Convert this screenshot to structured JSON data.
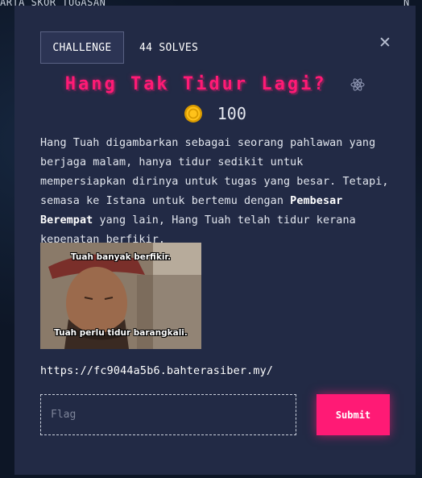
{
  "background": {
    "nav_left": "ARTA SKOR  TUGASAN",
    "nav_right": "N"
  },
  "modal": {
    "tag_label": "CHALLENGE",
    "solves": "44 SOLVES",
    "close_icon": "close-icon",
    "title": "Hang Tak Tidur Lagi?",
    "difficulty_icon": "atom-icon",
    "points_icon": "coin-icon",
    "points": "100",
    "description": {
      "part1": "Hang Tuah digambarkan sebagai seorang pahlawan yang berjaga malam, hanya tidur sedikit untuk mempersiapkan dirinya untuk tugas yang besar. Tetapi, semasa ke Istana untuk bertemu dengan ",
      "bold": "Pembesar Berempat",
      "part2": " yang lain, Hang Tuah telah tidur kerana kepenatan berfikir."
    },
    "meme": {
      "top_text": "Tuah banyak berfikir.",
      "bottom_text": "Tuah perlu tidur barangkali."
    },
    "link": "https://fc9044a5b6.bahterasiber.my/",
    "flag_placeholder": "Flag",
    "flag_value": "",
    "submit_label": "Submit"
  },
  "colors": {
    "accent": "#ff1a75",
    "modal_bg": "#222a45",
    "page_bg": "#0d1626"
  }
}
